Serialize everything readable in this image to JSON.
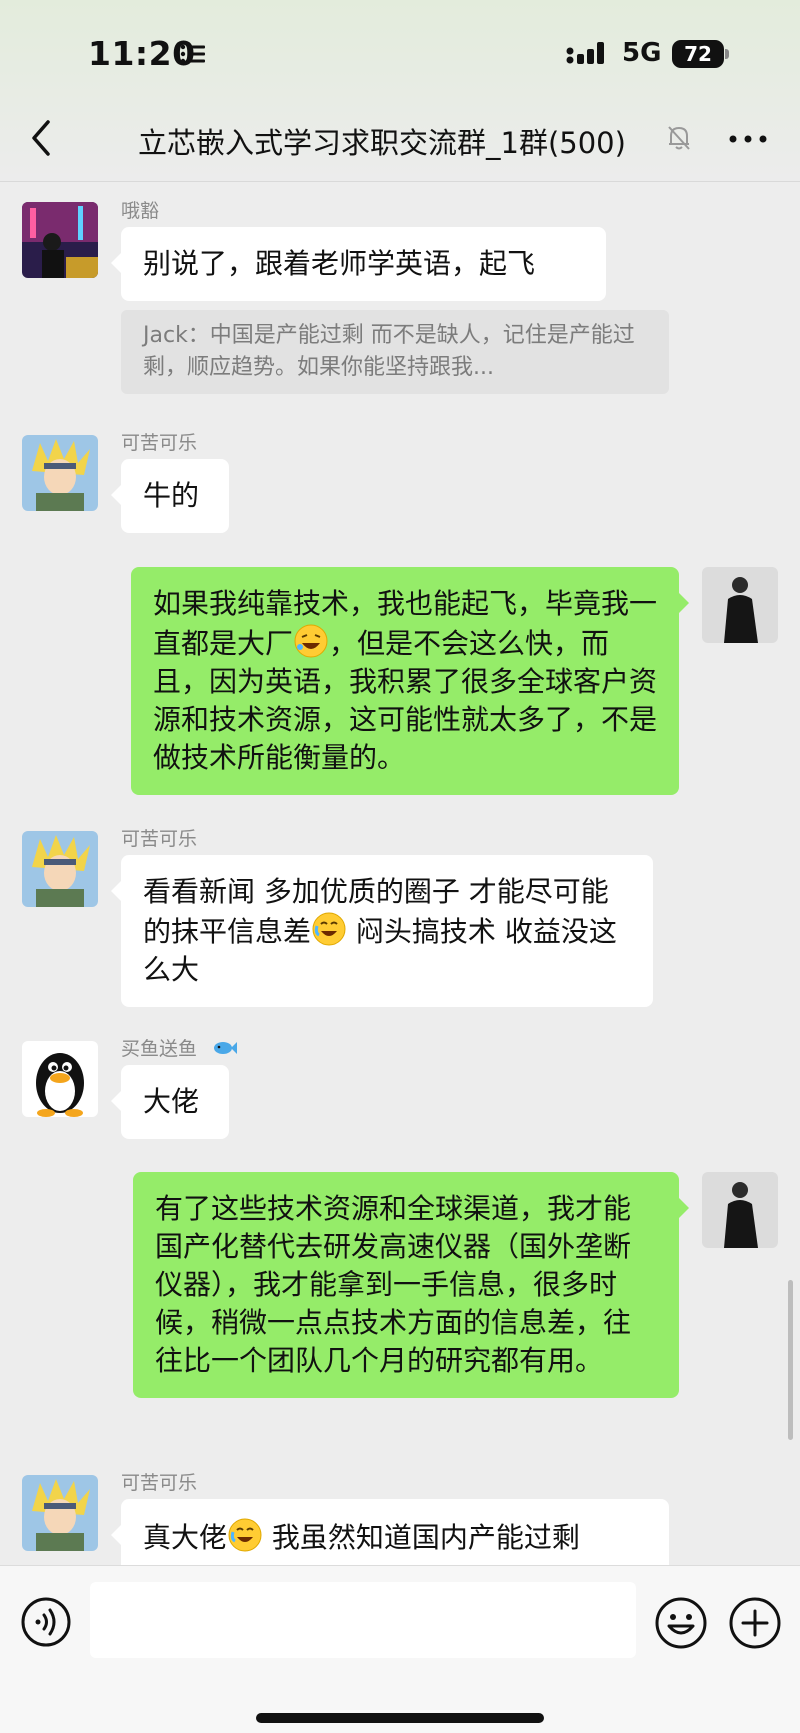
{
  "status_bar": {
    "time": "11:20",
    "network": "5G",
    "battery": "72"
  },
  "header": {
    "title": "立芯嵌入式学习求职交流群_1群(500)"
  },
  "messages": [
    {
      "sender": "哦豁",
      "text": "别说了，跟着老师学英语，起飞",
      "quote": "Jack：中国是产能过剩 而不是缺人，记住是产能过剩，顺应趋势。如果你能坚持跟我..."
    },
    {
      "sender": "可苦可乐",
      "text": "牛的"
    },
    {
      "sender": "me",
      "text_a": "如果我纯靠技术，我也能起飞，毕竟我一直都是大厂",
      "text_b": "，但是不会这么快，而且，因为英语，我积累了很多全球客户资源和技术资源，这可能性就太多了，不是做技术所能衡量的。"
    },
    {
      "sender": "可苦可乐",
      "text_a": "看看新闻 多加优质的圈子 才能尽可能的抹平信息差",
      "text_b": " 闷头搞技术 收益没这么大"
    },
    {
      "sender": "买鱼送鱼",
      "text": "大佬"
    },
    {
      "sender": "me",
      "text": "有了这些技术资源和全球渠道，我才能国产化替代去研发高速仪器（国外垄断仪器），我才能拿到一手信息，很多时候，稍微一点点技术方面的信息差，往往比一个团队几个月的研究都有用。"
    },
    {
      "sender": "可苦可乐",
      "text_a": "真大佬",
      "text_b": " 我虽然知道国内产能过剩"
    }
  ],
  "icons": {
    "voice": "voice-icon",
    "emoji": "emoji-icon",
    "plus": "plus-icon",
    "back": "back-chevron-icon",
    "more": "more-dots-icon",
    "mute": "mute-bell-icon"
  },
  "colors": {
    "self_bubble": "#95ec69",
    "other_bubble": "#ffffff",
    "background": "#ededed"
  }
}
